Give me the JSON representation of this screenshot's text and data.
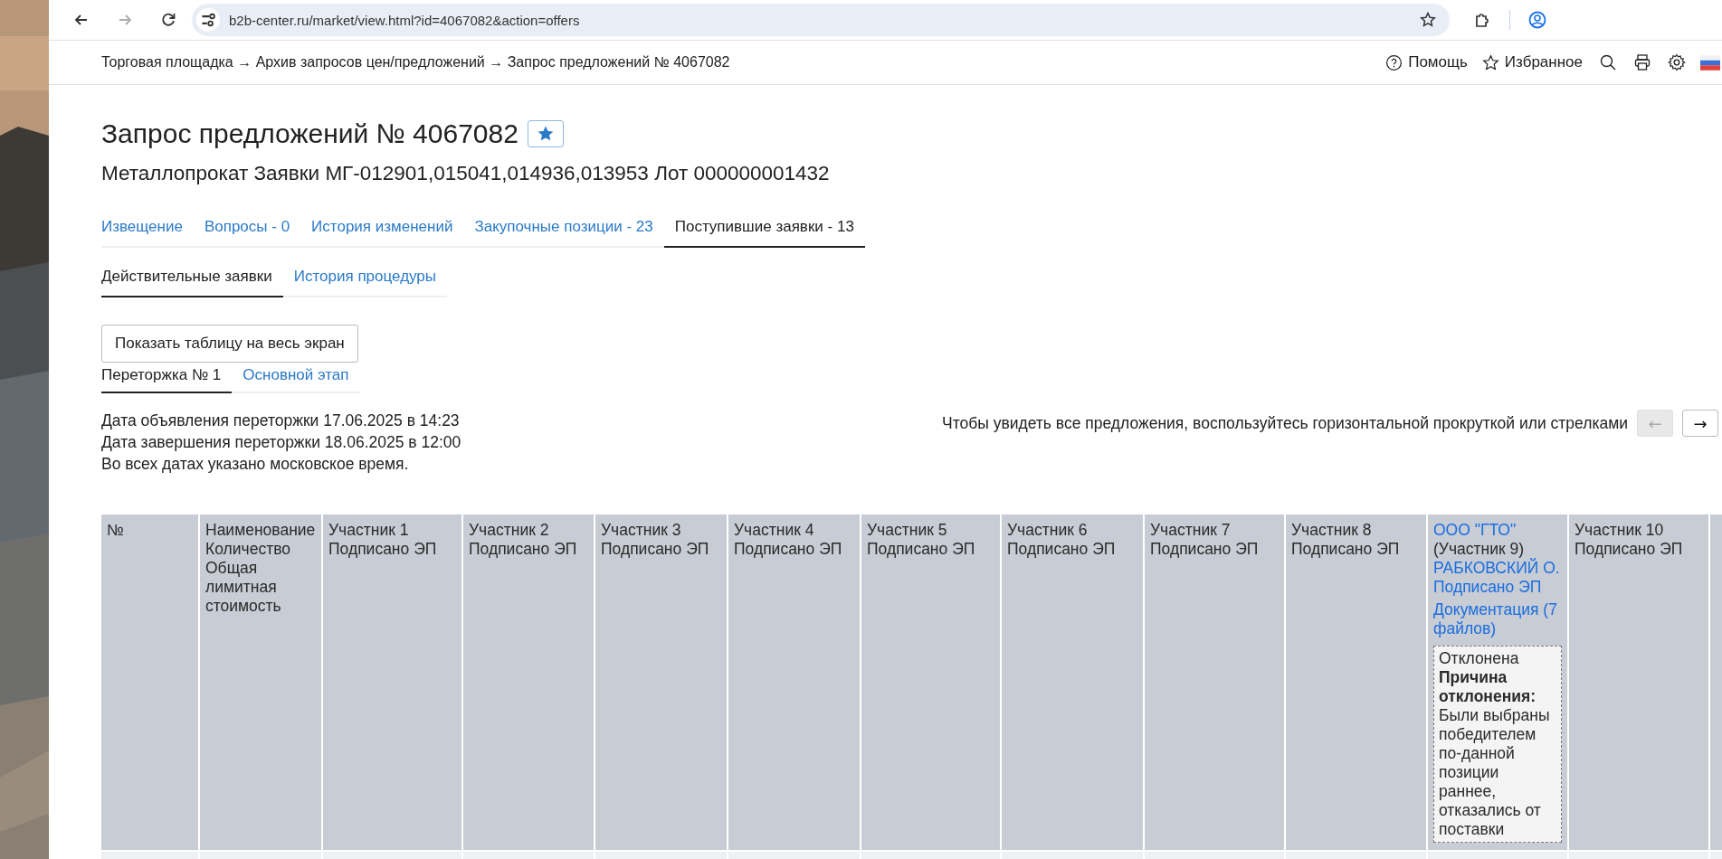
{
  "browser": {
    "url": "b2b-center.ru/market/view.html?id=4067082&action=offers",
    "back_disabled": false,
    "forward_disabled": true
  },
  "breadcrumb": "Торговая площадка → Архив запросов цен/предложений → Запрос предложений № 4067082",
  "header_links": [
    {
      "label": "Помощь",
      "kind": "help"
    },
    {
      "label": "Избранное",
      "kind": "favorite"
    }
  ],
  "title": "Запрос предложений № 4067082",
  "subtitle": "Металлопрокат Заявки МГ-012901,015041,014936,013953 Лот 000000001432",
  "tabs": [
    {
      "label": "Извещение",
      "selected": false
    },
    {
      "label": "Вопросы - 0",
      "selected": false
    },
    {
      "label": "История изменений",
      "selected": false
    },
    {
      "label": "Закупочные позиции - 23",
      "selected": false
    },
    {
      "label": "Поступившие заявки - 13",
      "selected": true
    }
  ],
  "subtabs": [
    {
      "label": "Действительные заявки",
      "selected": true
    },
    {
      "label": "История процедуры",
      "selected": false
    }
  ],
  "fullscreen_button": "Показать таблицу на весь экран",
  "stage_tabs": [
    {
      "label": "Переторжка № 1",
      "selected": true
    },
    {
      "label": "Основной этап",
      "selected": false
    }
  ],
  "dates": [
    "Дата объявления переторжки 17.06.2025 в 14:23",
    "Дата завершения переторжки 18.06.2025 в 12:00",
    "Во всех датах указано московское время."
  ],
  "scroll_hint": "Чтобы увидеть все предложения, воспользуйтесь горизонтальной прокруткой или стрелками",
  "scroll_buttons": [
    {
      "label": "←",
      "disabled": true
    },
    {
      "label": "→",
      "disabled": false
    }
  ],
  "table": {
    "columns": [
      {
        "kind": "plain",
        "lines": [
          "№"
        ]
      },
      {
        "kind": "plain",
        "lines": [
          "Наименование",
          "Количество",
          "Общая лимитная стоимость"
        ]
      },
      {
        "kind": "plain",
        "lines": [
          "Участник 1",
          "Подписано ЭП"
        ]
      },
      {
        "kind": "plain",
        "lines": [
          "Участник 2",
          "Подписано ЭП"
        ]
      },
      {
        "kind": "plain",
        "lines": [
          "Участник 3",
          "Подписано ЭП"
        ]
      },
      {
        "kind": "plain",
        "lines": [
          "Участник 4",
          "Подписано ЭП"
        ]
      },
      {
        "kind": "plain",
        "lines": [
          "Участник 5",
          "Подписано ЭП"
        ]
      },
      {
        "kind": "plain",
        "lines": [
          "Участник 6",
          "Подписано ЭП"
        ]
      },
      {
        "kind": "plain",
        "lines": [
          "Участник 7",
          "Подписано ЭП"
        ]
      },
      {
        "kind": "plain",
        "lines": [
          "Участник 8",
          "Подписано ЭП"
        ]
      },
      {
        "kind": "offer",
        "company": "ООО \"ГТО\"",
        "participant": "(Участник 9)",
        "signer": "РАБКОВСКИЙ О. Подписано ЭП",
        "documents": "Документация (7 файлов)",
        "status": "Отклонена",
        "reason_title": "Причина отклонения:",
        "reason": "Были выбраны победителем по-данной позиции раннее, отказались от поставки"
      },
      {
        "kind": "plain",
        "lines": [
          "Участник 10",
          "Подписано ЭП"
        ]
      },
      {
        "kind": "blank"
      }
    ]
  }
}
